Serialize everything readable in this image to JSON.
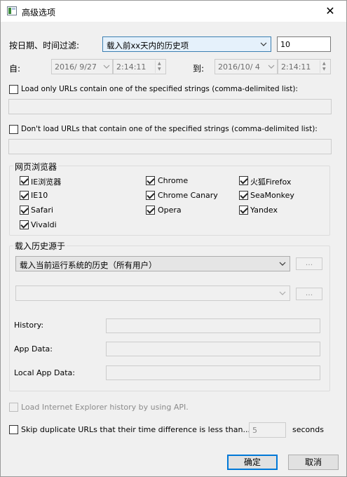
{
  "window": {
    "title": "高级选项",
    "close": "✕"
  },
  "date_filter": {
    "label": "按日期、时间过滤:",
    "mode": "载入前xx天内的历史项",
    "days": "10",
    "from_label": "自:",
    "to_label": "到:",
    "from_date": "2016/ 9/27",
    "from_time": "2:14:11",
    "to_date": "2016/10/ 4",
    "to_time": "2:14:11"
  },
  "url_include": {
    "label": "Load only URLs contain one of the specified strings (comma-delimited list):",
    "value": ""
  },
  "url_exclude": {
    "label": "Don't load URLs that contain one of the specified strings (comma-delimited list):",
    "value": ""
  },
  "browsers": {
    "title": "网页浏览器",
    "items": [
      {
        "label": "IE浏览器",
        "checked": true
      },
      {
        "label": "Chrome",
        "checked": true
      },
      {
        "label": "火狐Firefox",
        "checked": true
      },
      {
        "label": "IE10",
        "checked": true
      },
      {
        "label": "Chrome Canary",
        "checked": true
      },
      {
        "label": "SeaMonkey",
        "checked": true
      },
      {
        "label": "Safari",
        "checked": true
      },
      {
        "label": "Opera",
        "checked": true
      },
      {
        "label": "Yandex",
        "checked": true
      },
      {
        "label": "Vivaldi",
        "checked": true
      }
    ]
  },
  "source": {
    "title": "载入历史源于",
    "selected": "载入当前运行系统的历史（所有用户）",
    "browse": "...",
    "secondary_value": "",
    "history_label": "History:",
    "appdata_label": "App Data:",
    "localappdata_label": "Local App Data:"
  },
  "ie_api": {
    "label": "Load Internet Explorer history by using API."
  },
  "skip_duplicates": {
    "label": "Skip duplicate URLs that their time difference is less than...",
    "value": "5",
    "unit": "seconds"
  },
  "buttons": {
    "ok": "确定",
    "cancel": "取消"
  }
}
